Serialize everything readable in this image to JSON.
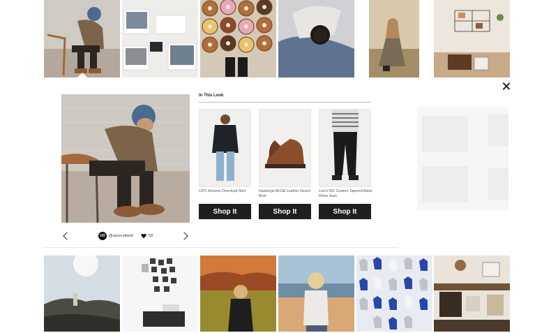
{
  "close": {
    "label": "×"
  },
  "look": {
    "heading": "In This Look",
    "products": [
      {
        "name": "CPO Stevens Overdyed Shirt",
        "button": "Shop It"
      },
      {
        "name": "Hawkings McGill Leather Desert Boot",
        "button": "Shop It"
      },
      {
        "name": "Levi's 501 Custom Tapered Black Rinse Jean",
        "button": "Shop It"
      }
    ]
  },
  "footer": {
    "logo_text": "UO",
    "handle": "@ussscotland",
    "likes": "59"
  },
  "colors": {
    "button_bg": "#1f1f1f",
    "text": "#222222"
  }
}
